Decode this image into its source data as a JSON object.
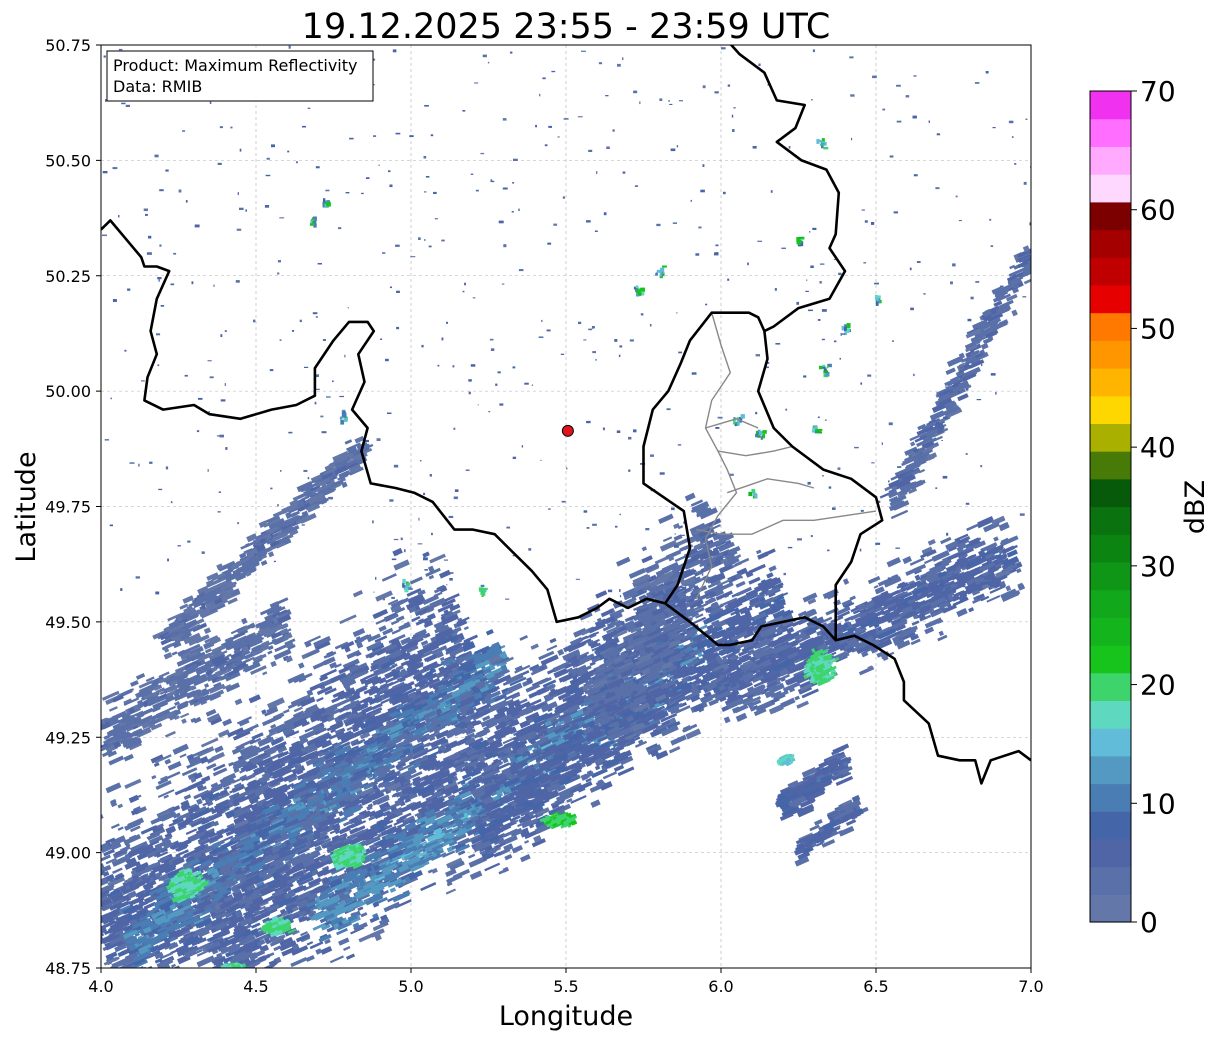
{
  "chart_data": {
    "type": "heatmap",
    "title": "19.12.2025 23:55 - 23:59 UTC",
    "xlabel": "Longitude",
    "ylabel": "Latitude",
    "xlim": [
      4.0,
      7.0
    ],
    "ylim": [
      48.75,
      50.75
    ],
    "x_ticks": [
      4.0,
      4.5,
      5.0,
      5.5,
      6.0,
      6.5,
      7.0
    ],
    "x_tick_labels": [
      "4.0",
      "4.5",
      "5.0",
      "5.5",
      "6.0",
      "6.5",
      "7.0"
    ],
    "y_ticks": [
      48.75,
      49.0,
      49.25,
      49.5,
      49.75,
      50.0,
      50.25,
      50.5,
      50.75
    ],
    "y_tick_labels": [
      "48.75",
      "49.00",
      "49.25",
      "49.50",
      "49.75",
      "50.00",
      "50.25",
      "50.50",
      "50.75"
    ],
    "grid": true,
    "annotation": {
      "lines": [
        "Product: Maximum Reflectivity",
        "Data: RMIB"
      ],
      "placement": "top-left"
    },
    "radar_site": {
      "lon": 5.506,
      "lat": 49.914,
      "color": "#e0141e"
    },
    "colorbar": {
      "label": "dBZ",
      "range": [
        0,
        70
      ],
      "tick_values": [
        0,
        10,
        20,
        30,
        40,
        50,
        60,
        70
      ],
      "tick_labels": [
        "0",
        "10",
        "20",
        "30",
        "40",
        "50",
        "60",
        "70"
      ],
      "step": 2.5,
      "colors": [
        "#6377a8",
        "#5970a8",
        "#4f65a6",
        "#4466a8",
        "#4a7db3",
        "#5399c2",
        "#60bcd9",
        "#5fd8c0",
        "#3dd46c",
        "#16c41c",
        "#14b41c",
        "#12a81c",
        "#0f9616",
        "#0c8412",
        "#0a720e",
        "#075a0a",
        "#477a06",
        "#aab000",
        "#ffd700",
        "#ffb400",
        "#ff9600",
        "#ff7800",
        "#e60000",
        "#c00000",
        "#a50000",
        "#7d0000",
        "#ffd8ff",
        "#ffaaff",
        "#ff6eff",
        "#f032f0"
      ]
    },
    "borders": {
      "country": [
        [
          [
            4.0,
            50.35
          ],
          [
            4.03,
            50.37
          ],
          [
            4.08,
            50.33
          ],
          [
            4.13,
            50.29
          ],
          [
            4.14,
            50.27
          ],
          [
            4.18,
            50.27
          ],
          [
            4.22,
            50.26
          ],
          [
            4.18,
            50.2
          ],
          [
            4.16,
            50.13
          ],
          [
            4.18,
            50.08
          ],
          [
            4.15,
            50.03
          ],
          [
            4.14,
            49.98
          ],
          [
            4.2,
            49.96
          ],
          [
            4.3,
            49.97
          ],
          [
            4.35,
            49.95
          ],
          [
            4.45,
            49.94
          ],
          [
            4.55,
            49.96
          ],
          [
            4.63,
            49.97
          ],
          [
            4.69,
            49.99
          ],
          [
            4.69,
            50.05
          ],
          [
            4.75,
            50.11
          ],
          [
            4.8,
            50.15
          ],
          [
            4.86,
            50.15
          ],
          [
            4.88,
            50.13
          ],
          [
            4.83,
            50.08
          ],
          [
            4.85,
            50.02
          ],
          [
            4.81,
            49.96
          ],
          [
            4.86,
            49.92
          ],
          [
            4.84,
            49.87
          ],
          [
            4.87,
            49.8
          ],
          [
            4.95,
            49.79
          ],
          [
            5.01,
            49.78
          ],
          [
            5.07,
            49.76
          ],
          [
            5.14,
            49.7
          ],
          [
            5.2,
            49.7
          ],
          [
            5.27,
            49.69
          ],
          [
            5.33,
            49.65
          ],
          [
            5.39,
            49.61
          ],
          [
            5.44,
            49.57
          ],
          [
            5.47,
            49.5
          ],
          [
            5.54,
            49.51
          ],
          [
            5.6,
            49.53
          ],
          [
            5.64,
            49.55
          ],
          [
            5.7,
            49.53
          ],
          [
            5.76,
            49.55
          ],
          [
            5.82,
            49.54
          ],
          [
            5.9,
            49.5
          ],
          [
            5.99,
            49.45
          ],
          [
            6.03,
            49.45
          ],
          [
            6.1,
            49.46
          ],
          [
            6.13,
            49.49
          ],
          [
            6.2,
            49.5
          ],
          [
            6.27,
            49.51
          ],
          [
            6.33,
            49.49
          ],
          [
            6.37,
            49.46
          ],
          [
            6.43,
            49.47
          ],
          [
            6.49,
            49.45
          ],
          [
            6.56,
            49.42
          ],
          [
            6.59,
            49.37
          ],
          [
            6.59,
            49.33
          ],
          [
            6.67,
            49.28
          ],
          [
            6.7,
            49.21
          ],
          [
            6.77,
            49.2
          ],
          [
            6.82,
            49.2
          ],
          [
            6.84,
            49.15
          ],
          [
            6.87,
            49.2
          ],
          [
            6.96,
            49.22
          ],
          [
            7.0,
            49.2
          ]
        ],
        [
          [
            6.02,
            50.76
          ],
          [
            6.06,
            50.73
          ],
          [
            6.14,
            50.69
          ],
          [
            6.18,
            50.63
          ],
          [
            6.27,
            50.62
          ],
          [
            6.24,
            50.57
          ],
          [
            6.18,
            50.54
          ],
          [
            6.26,
            50.5
          ],
          [
            6.34,
            50.48
          ],
          [
            6.38,
            50.43
          ],
          [
            6.37,
            50.34
          ],
          [
            6.35,
            50.31
          ],
          [
            6.4,
            50.26
          ],
          [
            6.35,
            50.2
          ],
          [
            6.25,
            50.18
          ],
          [
            6.17,
            50.14
          ],
          [
            6.14,
            50.13
          ],
          [
            6.12,
            50.16
          ],
          [
            6.09,
            50.17
          ],
          [
            5.97,
            50.17
          ],
          [
            5.9,
            50.11
          ],
          [
            5.87,
            50.06
          ],
          [
            5.83,
            50.0
          ],
          [
            5.78,
            49.96
          ],
          [
            5.75,
            49.88
          ],
          [
            5.75,
            49.8
          ],
          [
            5.88,
            49.74
          ],
          [
            5.9,
            49.66
          ],
          [
            5.86,
            49.58
          ],
          [
            5.82,
            49.54
          ]
        ],
        [
          [
            6.14,
            50.13
          ],
          [
            6.15,
            50.07
          ],
          [
            6.12,
            50.0
          ],
          [
            6.17,
            49.92
          ],
          [
            6.23,
            49.88
          ],
          [
            6.33,
            49.83
          ],
          [
            6.42,
            49.81
          ],
          [
            6.5,
            49.77
          ],
          [
            6.52,
            49.72
          ],
          [
            6.45,
            49.69
          ],
          [
            6.42,
            49.63
          ],
          [
            6.37,
            49.58
          ],
          [
            6.37,
            49.46
          ]
        ]
      ],
      "region": [
        [
          [
            5.97,
            50.17
          ],
          [
            6.0,
            50.1
          ],
          [
            6.03,
            50.04
          ],
          [
            5.97,
            49.98
          ],
          [
            5.95,
            49.92
          ],
          [
            5.99,
            49.87
          ],
          [
            6.02,
            49.83
          ],
          [
            6.05,
            49.78
          ],
          [
            5.99,
            49.73
          ],
          [
            5.95,
            49.68
          ],
          [
            5.97,
            49.62
          ],
          [
            5.92,
            49.55
          ]
        ],
        [
          [
            5.92,
            49.7
          ],
          [
            6.0,
            49.69
          ],
          [
            6.1,
            49.69
          ],
          [
            6.2,
            49.72
          ],
          [
            6.3,
            49.72
          ],
          [
            6.4,
            49.73
          ],
          [
            6.5,
            49.74
          ]
        ],
        [
          [
            5.95,
            49.92
          ],
          [
            6.05,
            49.94
          ],
          [
            6.12,
            49.92
          ]
        ],
        [
          [
            5.99,
            49.87
          ],
          [
            6.08,
            49.86
          ],
          [
            6.17,
            49.87
          ],
          [
            6.23,
            49.88
          ]
        ],
        [
          [
            6.02,
            49.78
          ],
          [
            6.15,
            49.81
          ],
          [
            6.25,
            49.8
          ],
          [
            6.3,
            49.79
          ]
        ]
      ]
    },
    "echoes": [
      {
        "lon1": 4.0,
        "lat1": 48.8,
        "lon2": 5.2,
        "lat2": 49.45,
        "w": 0.32,
        "dbz": 6,
        "n": 2400
      },
      {
        "lon1": 4.1,
        "lat1": 48.8,
        "lon2": 5.3,
        "lat2": 49.42,
        "w": 0.1,
        "dbz": 12,
        "n": 700
      },
      {
        "lon1": 4.35,
        "lat1": 48.78,
        "lon2": 5.9,
        "lat2": 49.5,
        "w": 0.25,
        "dbz": 6,
        "n": 1800
      },
      {
        "lon1": 4.7,
        "lat1": 48.85,
        "lon2": 5.95,
        "lat2": 49.45,
        "w": 0.09,
        "dbz": 13,
        "n": 650
      },
      {
        "lon1": 5.2,
        "lat1": 49.05,
        "lon2": 6.2,
        "lat2": 49.55,
        "w": 0.16,
        "dbz": 7,
        "n": 1100
      },
      {
        "lon1": 5.6,
        "lat1": 49.3,
        "lon2": 6.0,
        "lat2": 49.7,
        "w": 0.15,
        "dbz": 5,
        "n": 500
      },
      {
        "lon1": 4.2,
        "lat1": 49.45,
        "lon2": 4.85,
        "lat2": 49.88,
        "w": 0.05,
        "dbz": 4,
        "n": 380
      },
      {
        "lon1": 4.0,
        "lat1": 49.25,
        "lon2": 4.6,
        "lat2": 49.5,
        "w": 0.1,
        "dbz": 4,
        "n": 400
      },
      {
        "lon1": 6.0,
        "lat1": 49.35,
        "lon2": 6.95,
        "lat2": 49.65,
        "w": 0.12,
        "dbz": 6,
        "n": 900
      },
      {
        "lon1": 6.2,
        "lat1": 49.1,
        "lon2": 6.4,
        "lat2": 49.2,
        "w": 0.05,
        "dbz": 7,
        "n": 160
      },
      {
        "lon1": 6.55,
        "lat1": 49.75,
        "lon2": 7.0,
        "lat2": 50.3,
        "w": 0.05,
        "dbz": 5,
        "n": 280
      },
      {
        "lon1": 6.25,
        "lat1": 49.0,
        "lon2": 6.45,
        "lat2": 49.1,
        "w": 0.04,
        "dbz": 6,
        "n": 90
      }
    ],
    "echo_cores": [
      {
        "lon": 4.28,
        "lat": 48.93,
        "rx": 0.07,
        "ry": 0.04,
        "dbz": 20
      },
      {
        "lon": 4.8,
        "lat": 48.99,
        "rx": 0.06,
        "ry": 0.03,
        "dbz": 20
      },
      {
        "lon": 5.48,
        "lat": 49.07,
        "rx": 0.06,
        "ry": 0.015,
        "dbz": 22
      },
      {
        "lon": 4.57,
        "lat": 48.84,
        "rx": 0.05,
        "ry": 0.02,
        "dbz": 20
      },
      {
        "lon": 6.32,
        "lat": 49.4,
        "rx": 0.06,
        "ry": 0.05,
        "dbz": 20
      },
      {
        "lon": 6.21,
        "lat": 49.2,
        "rx": 0.02,
        "ry": 0.01,
        "dbz": 18
      },
      {
        "lon": 4.42,
        "lat": 48.75,
        "rx": 0.04,
        "ry": 0.01,
        "dbz": 20
      }
    ],
    "clutter": [
      {
        "lon": 6.32,
        "lat": 50.54
      },
      {
        "lon": 6.4,
        "lat": 50.14
      },
      {
        "lon": 6.12,
        "lat": 49.91
      },
      {
        "lon": 6.3,
        "lat": 49.92
      },
      {
        "lon": 4.72,
        "lat": 50.41
      },
      {
        "lon": 4.68,
        "lat": 50.37
      },
      {
        "lon": 5.73,
        "lat": 50.22
      },
      {
        "lon": 5.8,
        "lat": 50.26
      },
      {
        "lon": 4.78,
        "lat": 49.95
      },
      {
        "lon": 6.05,
        "lat": 49.94
      },
      {
        "lon": 6.1,
        "lat": 49.78
      },
      {
        "lon": 4.98,
        "lat": 49.58
      },
      {
        "lon": 5.23,
        "lat": 49.57
      },
      {
        "lon": 6.25,
        "lat": 50.33
      },
      {
        "lon": 6.5,
        "lat": 50.2
      },
      {
        "lon": 6.33,
        "lat": 50.05
      }
    ]
  }
}
